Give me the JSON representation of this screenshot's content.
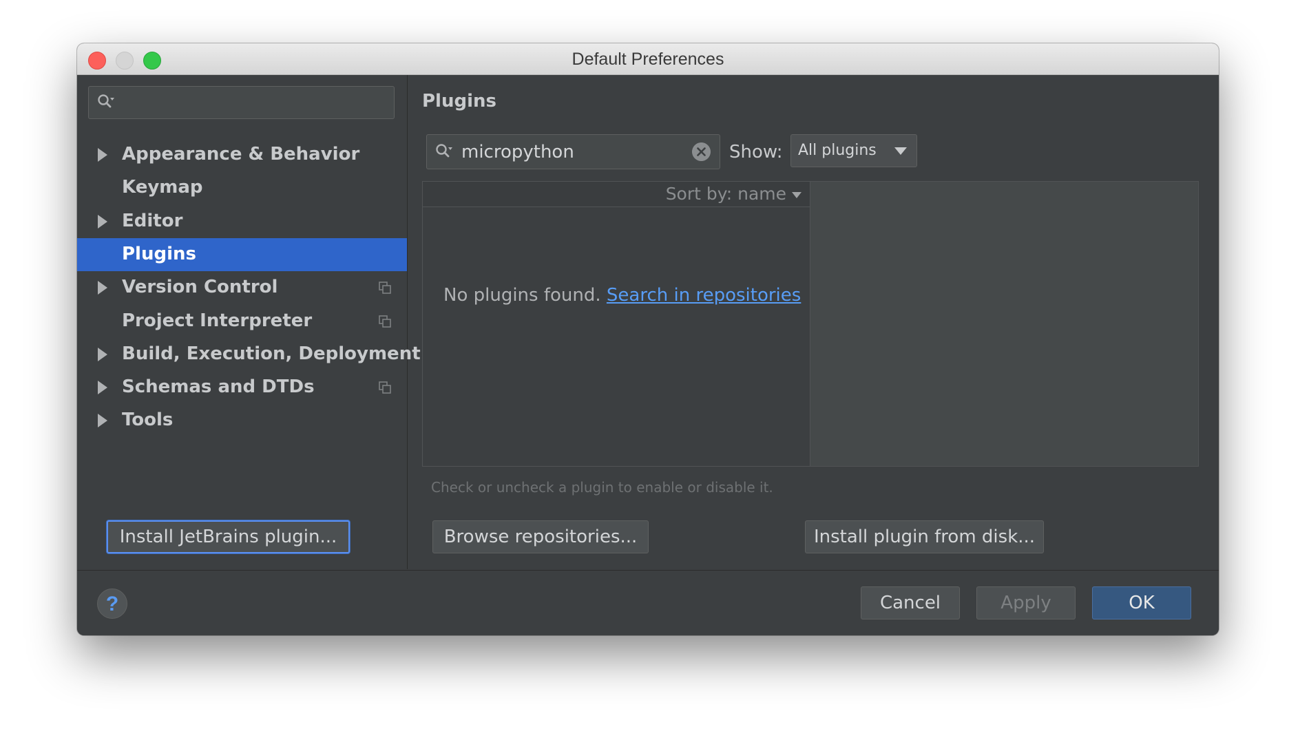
{
  "window": {
    "title": "Default Preferences"
  },
  "sidebar": {
    "search_placeholder": "",
    "items": [
      {
        "label": "Appearance & Behavior",
        "expandable": true,
        "selected": false,
        "copy_icon": false
      },
      {
        "label": "Keymap",
        "expandable": false,
        "selected": false,
        "copy_icon": false
      },
      {
        "label": "Editor",
        "expandable": true,
        "selected": false,
        "copy_icon": false
      },
      {
        "label": "Plugins",
        "expandable": false,
        "selected": true,
        "copy_icon": false
      },
      {
        "label": "Version Control",
        "expandable": true,
        "selected": false,
        "copy_icon": true
      },
      {
        "label": "Project Interpreter",
        "expandable": false,
        "selected": false,
        "copy_icon": true
      },
      {
        "label": "Build, Execution, Deployment",
        "expandable": true,
        "selected": false,
        "copy_icon": false
      },
      {
        "label": "Schemas and DTDs",
        "expandable": true,
        "selected": false,
        "copy_icon": true
      },
      {
        "label": "Tools",
        "expandable": true,
        "selected": false,
        "copy_icon": false
      }
    ]
  },
  "main": {
    "title": "Plugins",
    "search": {
      "value": "micropython"
    },
    "show": {
      "label": "Show:",
      "selected": "All plugins"
    },
    "list": {
      "sort_label": "Sort by: name",
      "empty_message": "No plugins found.",
      "search_link": "Search in repositories"
    },
    "hint": "Check or uncheck a plugin to enable or disable it.",
    "buttons": {
      "install_jetbrains": "Install JetBrains plugin...",
      "browse_repositories": "Browse repositories...",
      "install_from_disk": "Install plugin from disk..."
    }
  },
  "footer": {
    "help": "?",
    "cancel": "Cancel",
    "apply": "Apply",
    "ok": "OK"
  },
  "colors": {
    "background": "#3c3f41",
    "selection": "#2f65ca",
    "link": "#589df6",
    "ok_button": "#365880"
  }
}
